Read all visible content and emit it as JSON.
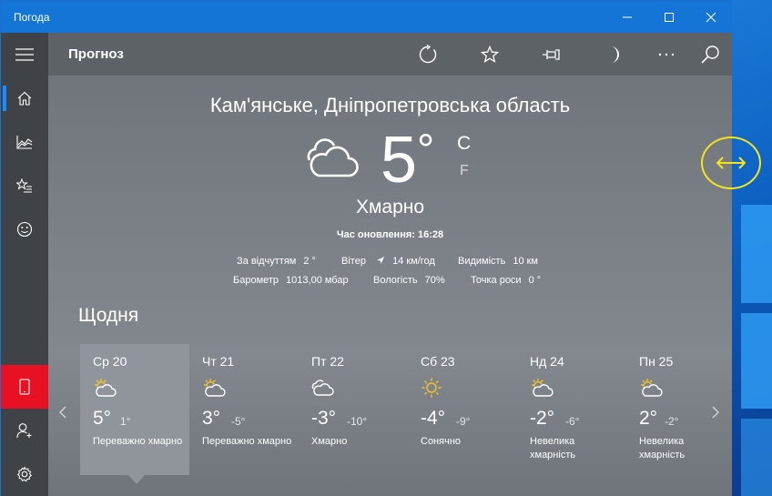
{
  "window": {
    "title": "Погода",
    "minimize": "—",
    "maximize": "☐",
    "close": "✕"
  },
  "header": {
    "title": "Прогноз"
  },
  "current": {
    "city": "Кам'янське, Дніпропетровська область",
    "temperature": "5",
    "degree": "°",
    "unit_c": "C",
    "unit_f": "F",
    "condition": "Хмарно",
    "updated": "Час оновлення: 16:28",
    "details": {
      "feels_label": "За відчуттям",
      "feels_value": "2 °",
      "wind_label": "Вітер",
      "wind_value": "14 км/год",
      "visibility_label": "Видимість",
      "visibility_value": "10 км",
      "barometer_label": "Барометр",
      "barometer_value": "1013,00 мбар",
      "humidity_label": "Вологість",
      "humidity_value": "70%",
      "dewpoint_label": "Точка роси",
      "dewpoint_value": "0 °"
    }
  },
  "daily": {
    "heading": "Щодня",
    "days": [
      {
        "name": "Ср 20",
        "hi": "5°",
        "lo": "1°",
        "cond": "Переважно хмарно",
        "icon": "partly-cloudy-icon"
      },
      {
        "name": "Чт 21",
        "hi": "3°",
        "lo": "-5°",
        "cond": "Переважно хмарно",
        "icon": "partly-cloudy-icon"
      },
      {
        "name": "Пт 22",
        "hi": "-3°",
        "lo": "-10°",
        "cond": "Хмарно",
        "icon": "cloud-icon"
      },
      {
        "name": "Сб 23",
        "hi": "-4°",
        "lo": "-9°",
        "cond": "Сонячно",
        "icon": "sun-icon"
      },
      {
        "name": "Нд 24",
        "hi": "-2°",
        "lo": "-6°",
        "cond": "Невелика хмарність",
        "icon": "partly-cloudy-icon"
      },
      {
        "name": "Пн 25",
        "hi": "2°",
        "lo": "-2°",
        "cond": "Невелика хмарність",
        "icon": "partly-cloudy-icon"
      }
    ]
  },
  "colors": {
    "titlebar": "#1475d6",
    "sidebar": "#3f4347",
    "accent": "#1a8cff",
    "red": "#e81123",
    "marker": "#f5e51b"
  }
}
